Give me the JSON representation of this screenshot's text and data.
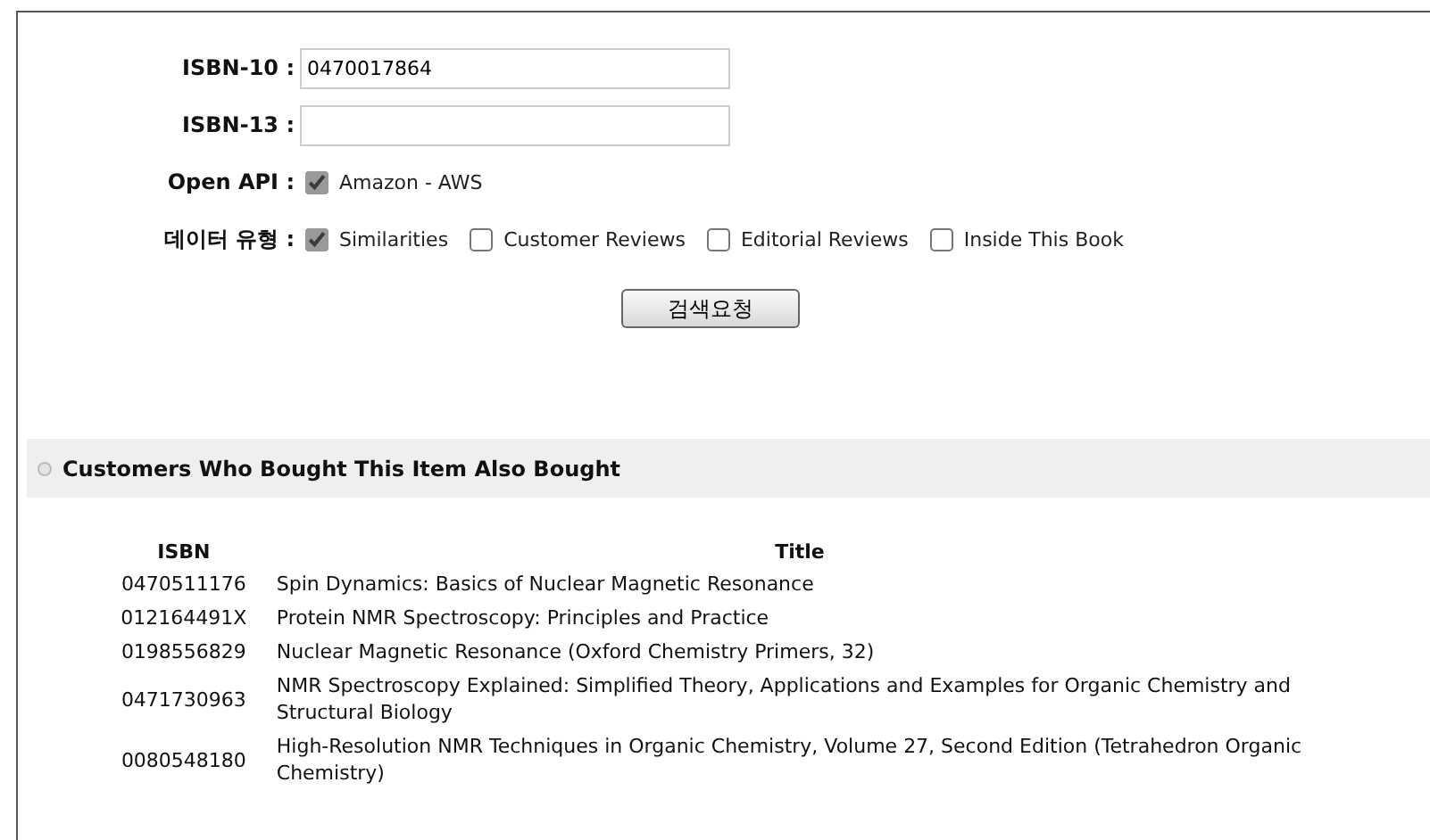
{
  "form": {
    "fields": [
      {
        "label": "ISBN-10 :",
        "value": "0470017864"
      },
      {
        "label": "ISBN-13 :"
      }
    ],
    "open_api": {
      "label": "Open API :",
      "options": [
        {
          "label": "Amazon - AWS",
          "checked": true
        }
      ]
    },
    "data_type": {
      "label": "데이터 유형 :",
      "options": [
        {
          "label": "Similarities",
          "checked": true
        },
        {
          "label": "Customer Reviews",
          "checked": false
        },
        {
          "label": "Editorial Reviews",
          "checked": false
        },
        {
          "label": "Inside This Book",
          "checked": false
        }
      ]
    },
    "submit": "검색요청"
  },
  "section": {
    "title": "Customers Who Bought This Item Also Bought"
  },
  "table": {
    "columns": [
      "ISBN",
      "Title"
    ],
    "rows": [
      {
        "isbn": "0470511176",
        "title": "Spin Dynamics: Basics of Nuclear Magnetic Resonance"
      },
      {
        "isbn": "012164491X",
        "title": "Protein NMR Spectroscopy: Principles and Practice"
      },
      {
        "isbn": "0198556829",
        "title": "Nuclear Magnetic Resonance (Oxford Chemistry Primers, 32)"
      },
      {
        "isbn": "0471730963",
        "title": "NMR Spectroscopy Explained: Simplified Theory, Applications and Examples for Organic Chemistry and Structural Biology"
      },
      {
        "isbn": "0080548180",
        "title": "High-Resolution NMR Techniques in Organic Chemistry, Volume 27, Second Edition (Tetrahedron Organic Chemistry)"
      }
    ]
  }
}
